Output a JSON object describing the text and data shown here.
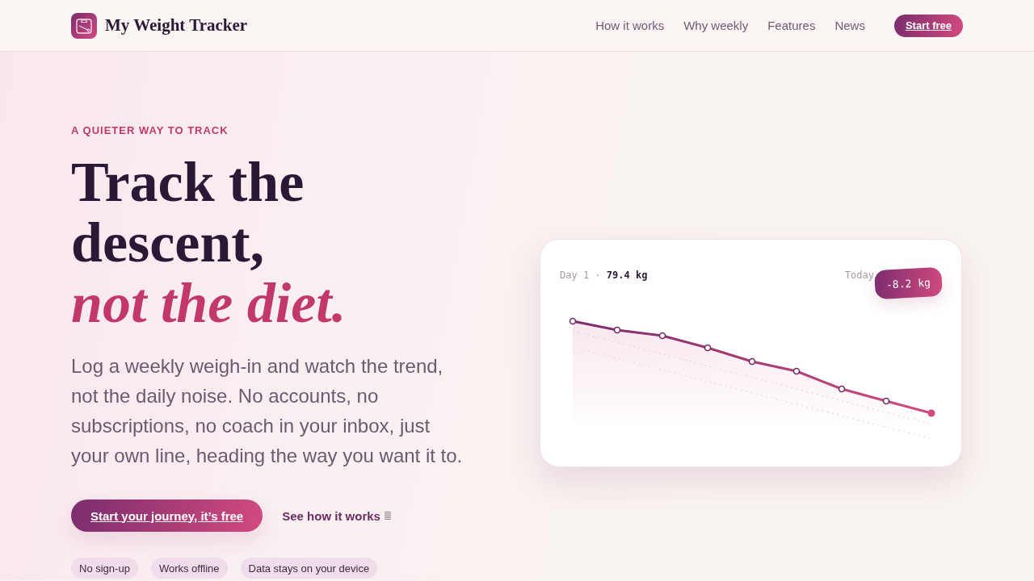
{
  "header": {
    "brand": "My Weight Tracker",
    "nav": [
      "How it works",
      "Why weekly",
      "Features",
      "News"
    ],
    "cta": "Start free"
  },
  "hero": {
    "eyebrow": "A QUIETER WAY TO TRACK",
    "headline": "Track the descent, *not the diet.*",
    "lead": "Log a weekly weigh-in and watch the trend, not the daily noise. No accounts, no subscriptions, no coach in your inbox, just your own line, heading the way you want it to.",
    "primary_cta": "Start your journey, it’s free",
    "secondary_link": "See how it works",
    "tags": [
      "No sign-up",
      "Works offline",
      "Data stays on your device"
    ]
  },
  "preview_card": {
    "start_label": "Day 1 · **79.4 kg**",
    "end_label": "Today",
    "change_badge": "-8.2 kg"
  }
}
